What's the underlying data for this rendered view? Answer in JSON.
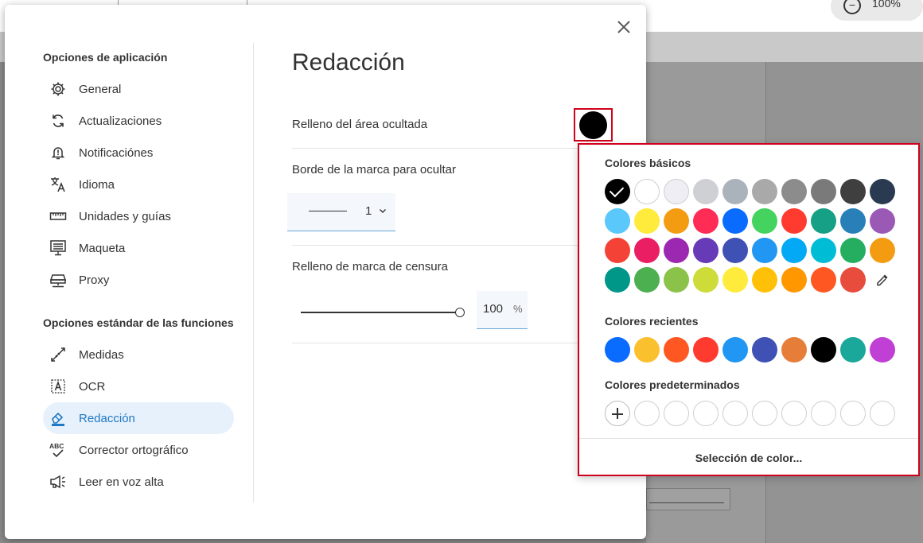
{
  "background": {
    "zoom_value": "100%",
    "zoom_minus": "−"
  },
  "sidebar": {
    "app_section_title": "Opciones de aplicación",
    "app_items": [
      {
        "label": "General",
        "icon": "gear-icon"
      },
      {
        "label": "Actualizaciones",
        "icon": "sync-icon"
      },
      {
        "label": "Notificaciónes",
        "icon": "bell-icon"
      },
      {
        "label": "Idioma",
        "icon": "translate-icon"
      },
      {
        "label": "Unidades y guías",
        "icon": "ruler-icon"
      },
      {
        "label": "Maqueta",
        "icon": "layout-icon"
      },
      {
        "label": "Proxy",
        "icon": "proxy-icon"
      }
    ],
    "features_section_title": "Opciones estándar de las funciones",
    "feature_items": [
      {
        "label": "Medidas",
        "icon": "measure-icon"
      },
      {
        "label": "OCR",
        "icon": "ocr-icon"
      },
      {
        "label": "Redacción",
        "icon": "eraser-icon",
        "active": true
      },
      {
        "label": "Corrector ortográfico",
        "icon": "spellcheck-icon"
      },
      {
        "label": "Leer en voz alta",
        "icon": "megaphone-icon"
      }
    ]
  },
  "content": {
    "title": "Redacción",
    "fill_label": "Relleno del área ocultada",
    "fill_color": "#000000",
    "border_label": "Borde de la marca para ocultar",
    "border_value": "1",
    "censor_label": "Relleno de marca de censura",
    "censor_value": "100",
    "censor_unit": "%",
    "censor_fraction": 1.0
  },
  "color_popup": {
    "basic_title": "Colores básicos",
    "basic_colors": [
      [
        "#000000",
        "#ffffff",
        "#eeeef4",
        "#cfd0d4",
        "#aab2bb",
        "#a9a9a9",
        "#8c8c8c",
        "#7a7a7a",
        "#3f3f3f",
        "#2a3a50"
      ],
      [
        "#5ac8fa",
        "#ffeb3b",
        "#f39c12",
        "#ff2d55",
        "#0a6cff",
        "#43d35e",
        "#ff3b30",
        "#16a085",
        "#2980b9",
        "#9b59b6"
      ],
      [
        "#f44336",
        "#e91e63",
        "#9c27b0",
        "#673ab7",
        "#3f51b5",
        "#2196f3",
        "#03a9f4",
        "#00bcd4",
        "#26ae60",
        "#f39c12"
      ],
      [
        "#009688",
        "#4caf50",
        "#8bc34a",
        "#cddc39",
        "#ffeb3b",
        "#ffc107",
        "#ff9800",
        "#ff5722",
        "#e74c3c"
      ]
    ],
    "selected_basic": "#000000",
    "eyedropper_icon": "eyedropper-icon",
    "recent_title": "Colores recientes",
    "recent_colors": [
      "#0a6cff",
      "#fbc02d",
      "#ff5722",
      "#ff3b30",
      "#2196f3",
      "#3f51b5",
      "#e67e3a",
      "#000000",
      "#1aa89a",
      "#c03fd4"
    ],
    "predefined_title": "Colores predeterminados",
    "predefined_empty_count": 9,
    "add_icon": "plus-icon",
    "custom_link": "Selección de color..."
  }
}
